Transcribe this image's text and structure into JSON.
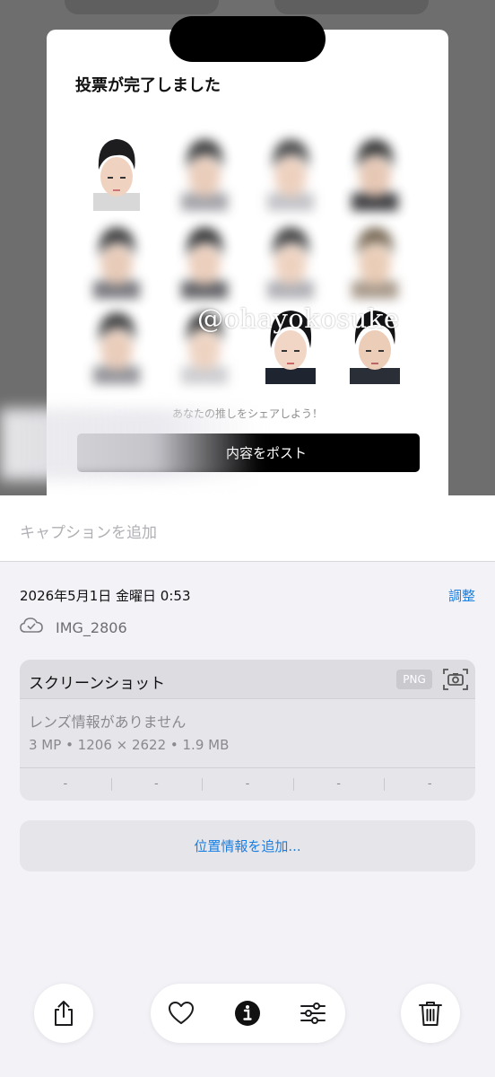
{
  "screenshot": {
    "card_title": "投票が完了しました",
    "watermark": "@ohayokosuke",
    "share_prompt": "あなたの推しをシェアしよう！",
    "post_button_label": "内容をポスト"
  },
  "caption": {
    "placeholder": "キャプションを追加"
  },
  "info": {
    "datetime": "2026年5月1日 金曜日 0:53",
    "adjust_label": "調整",
    "filename": "IMG_2806"
  },
  "meta": {
    "title": "スクリーンショット",
    "format_badge": "PNG",
    "lens_info": "レンズ情報がありません",
    "specs": "3 MP • 1206 × 2622 • 1.9 MB",
    "exif_values": [
      "-",
      "-",
      "-",
      "-",
      "-"
    ]
  },
  "location": {
    "label": "位置情報を追加..."
  },
  "toolbar": {
    "icons": [
      "share-icon",
      "heart-icon",
      "info-icon",
      "adjust-icon",
      "trash-icon"
    ]
  },
  "colors": {
    "accent": "#1a7fe0",
    "background": "#f2f2f7",
    "card": "#e5e5ea"
  }
}
